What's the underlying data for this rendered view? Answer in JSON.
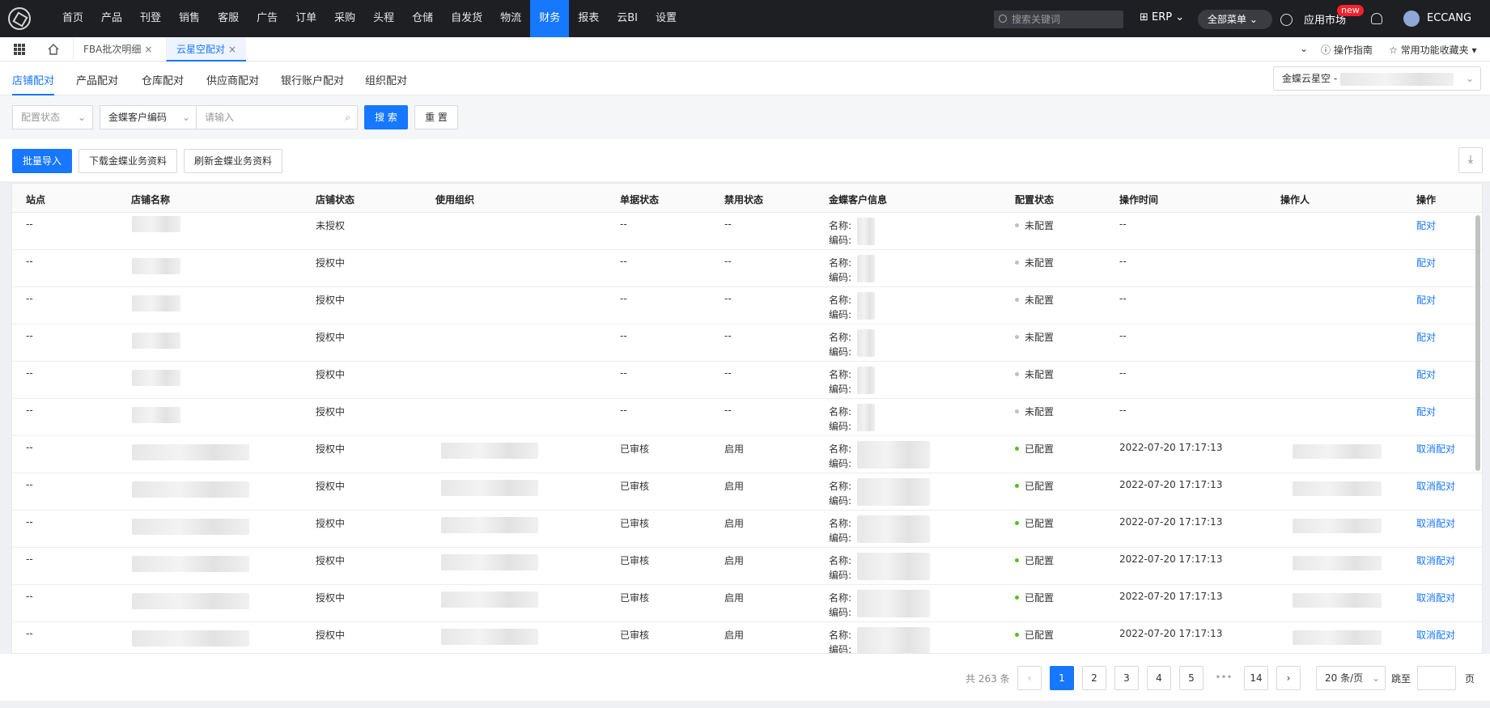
{
  "topbar": {
    "nav": [
      "首页",
      "产品",
      "刊登",
      "销售",
      "客服",
      "广告",
      "订单",
      "采购",
      "头程",
      "仓储",
      "自发货",
      "物流",
      "财务",
      "报表",
      "云BI",
      "设置"
    ],
    "active_nav": "财务",
    "search_placeholder": "搜索关键词",
    "erp_label": "ERP",
    "all_menu_label": "全部菜单",
    "market_label": "应用市场",
    "new_badge": "new",
    "user_name": "ECCANG"
  },
  "tabbar": {
    "tabs": [
      {
        "label": "FBA批次明细",
        "close": "×"
      },
      {
        "label": "云星空配对",
        "close": "×"
      }
    ],
    "active_tab": "云星空配对",
    "guide_label": "操作指南",
    "favorites_label": "常用功能收藏夹"
  },
  "subtabs": [
    "店铺配对",
    "产品配对",
    "仓库配对",
    "供应商配对",
    "银行账户配对",
    "组织配对"
  ],
  "org_select": "金蝶云星空 -",
  "filters": {
    "status_placeholder": "配置状态",
    "field_select": "金蝶客户编码",
    "input_placeholder": "请输入",
    "search_btn": "搜 索",
    "reset_btn": "重 置"
  },
  "actions": {
    "import_btn": "批量导入",
    "download_btn": "下载金蝶业务资料",
    "refresh_btn": "刷新金蝶业务资料"
  },
  "table": {
    "columns": [
      "站点",
      "店铺名称",
      "店铺状态",
      "使用组织",
      "单据状态",
      "禁用状态",
      "金蝶客户信息",
      "配置状态",
      "操作时间",
      "操作人",
      "操作"
    ],
    "name_label": "名称:",
    "code_label": "编码:",
    "rows": [
      {
        "site": "--",
        "shop_status": "未授权",
        "doc_status": "--",
        "disable_status": "--",
        "config_status": "未配置",
        "time": "--",
        "action": "配对"
      },
      {
        "site": "--",
        "shop_status": "授权中",
        "doc_status": "--",
        "disable_status": "--",
        "config_status": "未配置",
        "time": "--",
        "action": "配对"
      },
      {
        "site": "--",
        "shop_status": "授权中",
        "doc_status": "--",
        "disable_status": "--",
        "config_status": "未配置",
        "time": "--",
        "action": "配对"
      },
      {
        "site": "--",
        "shop_status": "授权中",
        "doc_status": "--",
        "disable_status": "--",
        "config_status": "未配置",
        "time": "--",
        "action": "配对"
      },
      {
        "site": "--",
        "shop_status": "授权中",
        "doc_status": "--",
        "disable_status": "--",
        "config_status": "未配置",
        "time": "--",
        "action": "配对"
      },
      {
        "site": "--",
        "shop_status": "授权中",
        "doc_status": "--",
        "disable_status": "--",
        "config_status": "未配置",
        "time": "--",
        "action": "配对"
      },
      {
        "site": "--",
        "shop_status": "授权中",
        "doc_status": "已审核",
        "disable_status": "启用",
        "config_status": "已配置",
        "time": "2022-07-20 17:17:13",
        "action": "取消配对"
      },
      {
        "site": "--",
        "shop_status": "授权中",
        "doc_status": "已审核",
        "disable_status": "启用",
        "config_status": "已配置",
        "time": "2022-07-20 17:17:13",
        "action": "取消配对"
      },
      {
        "site": "--",
        "shop_status": "授权中",
        "doc_status": "已审核",
        "disable_status": "启用",
        "config_status": "已配置",
        "time": "2022-07-20 17:17:13",
        "action": "取消配对"
      },
      {
        "site": "--",
        "shop_status": "授权中",
        "doc_status": "已审核",
        "disable_status": "启用",
        "config_status": "已配置",
        "time": "2022-07-20 17:17:13",
        "action": "取消配对"
      },
      {
        "site": "--",
        "shop_status": "授权中",
        "doc_status": "已审核",
        "disable_status": "启用",
        "config_status": "已配置",
        "time": "2022-07-20 17:17:13",
        "action": "取消配对"
      },
      {
        "site": "--",
        "shop_status": "授权中",
        "doc_status": "已审核",
        "disable_status": "启用",
        "config_status": "已配置",
        "time": "2022-07-20 17:17:13",
        "action": "取消配对"
      }
    ]
  },
  "colors": {
    "accent": "#1677ff",
    "configured": "#52c41a",
    "unconfigured": "#bfbfbf"
  },
  "pager": {
    "total": "共 263 条",
    "pages": [
      "1",
      "2",
      "3",
      "4",
      "5"
    ],
    "ellipsis": "•••",
    "last_page": "14",
    "active_page": "1",
    "page_size": "20 条/页",
    "jump_label": "跳至",
    "page_unit": "页"
  }
}
